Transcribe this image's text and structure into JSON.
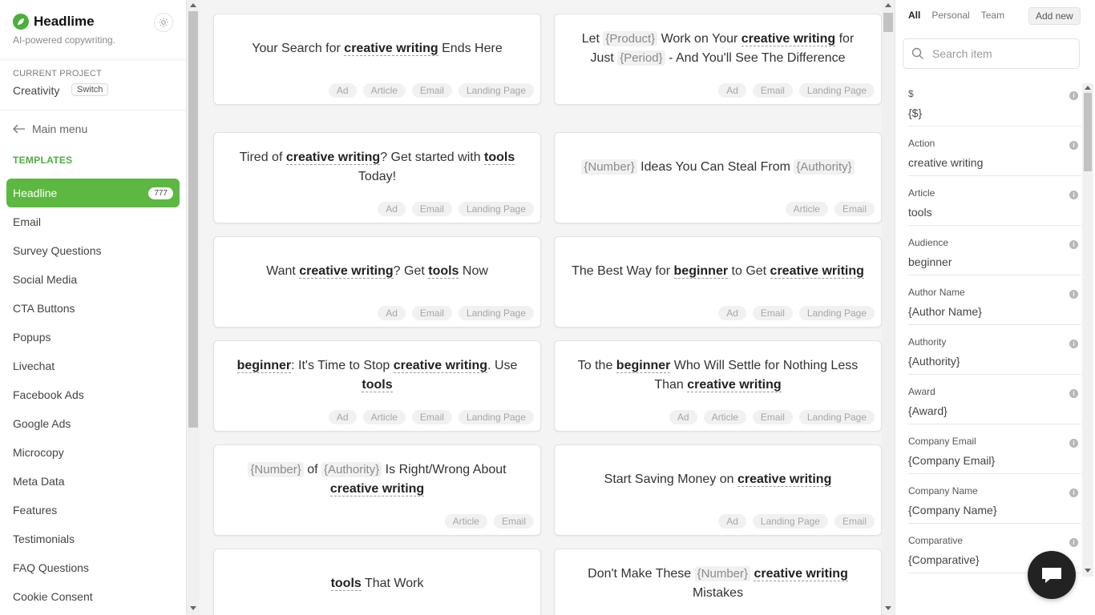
{
  "brand": {
    "name": "Headlime",
    "tagline": "AI-powered copywriting."
  },
  "project": {
    "label": "CURRENT PROJECT",
    "name": "Creativity",
    "switch_label": "Switch"
  },
  "nav": {
    "main_menu": "Main menu",
    "templates_label": "TEMPLATES"
  },
  "menu": [
    {
      "label": "Headline",
      "count": "777",
      "active": true
    },
    {
      "label": "Email"
    },
    {
      "label": "Survey Questions"
    },
    {
      "label": "Social Media"
    },
    {
      "label": "CTA Buttons"
    },
    {
      "label": "Popups"
    },
    {
      "label": "Livechat"
    },
    {
      "label": "Facebook Ads"
    },
    {
      "label": "Google Ads"
    },
    {
      "label": "Microcopy"
    },
    {
      "label": "Meta Data"
    },
    {
      "label": "Features"
    },
    {
      "label": "Testimonials"
    },
    {
      "label": "FAQ Questions"
    },
    {
      "label": "Cookie Consent"
    }
  ],
  "cards": [
    {
      "parts": [
        {
          "t": "Your Search for "
        },
        {
          "b": "creative writing"
        },
        {
          "t": " Ends Here"
        }
      ],
      "tags": [
        "Ad",
        "Article",
        "Email",
        "Landing Page"
      ]
    },
    {
      "parts": [
        {
          "t": "Let "
        },
        {
          "p": "{Product}"
        },
        {
          "t": " Work on Your "
        },
        {
          "b": "creative writing"
        },
        {
          "t": " for Just "
        },
        {
          "p": "{Period}"
        },
        {
          "t": " - And You'll See The Difference"
        }
      ],
      "tags": [
        "Ad",
        "Email",
        "Landing Page"
      ]
    },
    {
      "parts": [
        {
          "t": "Tired of "
        },
        {
          "b": "creative writing"
        },
        {
          "t": "? Get started with "
        },
        {
          "b": "tools"
        },
        {
          "t": " Today!"
        }
      ],
      "tags": [
        "Ad",
        "Email",
        "Landing Page"
      ]
    },
    {
      "parts": [
        {
          "p": "{Number}"
        },
        {
          "t": " Ideas You Can Steal From "
        },
        {
          "p": "{Authority}"
        }
      ],
      "tags": [
        "Article",
        "Email"
      ]
    },
    {
      "parts": [
        {
          "t": "Want "
        },
        {
          "b": "creative writing"
        },
        {
          "t": "? Get "
        },
        {
          "b": "tools"
        },
        {
          "t": " Now"
        }
      ],
      "tags": [
        "Ad",
        "Email",
        "Landing Page"
      ]
    },
    {
      "parts": [
        {
          "t": "The Best Way for "
        },
        {
          "b": "beginner"
        },
        {
          "t": " to Get "
        },
        {
          "b": "creative writing"
        }
      ],
      "tags": [
        "Ad",
        "Email",
        "Landing Page"
      ]
    },
    {
      "parts": [
        {
          "b": "beginner"
        },
        {
          "t": ": It's Time to Stop "
        },
        {
          "b": "creative writing"
        },
        {
          "t": ". Use "
        },
        {
          "b": "tools"
        }
      ],
      "tags": [
        "Ad",
        "Article",
        "Email",
        "Landing Page"
      ]
    },
    {
      "parts": [
        {
          "t": "To the "
        },
        {
          "b": "beginner"
        },
        {
          "t": " Who Will Settle for Nothing Less Than "
        },
        {
          "b": "creative writing"
        }
      ],
      "tags": [
        "Ad",
        "Article",
        "Email",
        "Landing Page"
      ]
    },
    {
      "parts": [
        {
          "p": "{Number}"
        },
        {
          "t": " of "
        },
        {
          "p": "{Authority}"
        },
        {
          "t": " Is Right/Wrong About "
        },
        {
          "b": "creative writing"
        }
      ],
      "tags": [
        "Article",
        "Email"
      ]
    },
    {
      "parts": [
        {
          "t": "Start Saving Money on "
        },
        {
          "b": "creative writing"
        }
      ],
      "tags": [
        "Ad",
        "Landing Page",
        "Email"
      ]
    },
    {
      "parts": [
        {
          "b": "tools"
        },
        {
          "t": " That Work"
        }
      ],
      "tags": []
    },
    {
      "parts": [
        {
          "t": "Don't Make These "
        },
        {
          "p": "{Number}"
        },
        {
          "t": " "
        },
        {
          "b": "creative writing"
        },
        {
          "t": " Mistakes"
        }
      ],
      "tags": []
    }
  ],
  "right_panel": {
    "tabs": [
      "All",
      "Personal",
      "Team"
    ],
    "add_new": "Add new",
    "search_placeholder": "Search item",
    "variables": [
      {
        "label": "$",
        "value": "{$}"
      },
      {
        "label": "Action",
        "value": "creative writing"
      },
      {
        "label": "Article",
        "value": "tools"
      },
      {
        "label": "Audience",
        "value": " beginner"
      },
      {
        "label": "Author Name",
        "value": "{Author Name}"
      },
      {
        "label": "Authority",
        "value": "{Authority}"
      },
      {
        "label": "Award",
        "value": "{Award}"
      },
      {
        "label": "Company Email",
        "value": "{Company Email}"
      },
      {
        "label": "Company Name",
        "value": "{Company Name}"
      },
      {
        "label": "Comparative",
        "value": "{Comparative}"
      }
    ]
  },
  "icons": {
    "info": "info-icon",
    "chat": "chat-icon",
    "search": "search-icon",
    "theme": "sun-icon",
    "back": "arrow-left-icon"
  },
  "colors": {
    "accent": "#5cb840",
    "templates_label": "#4caf3e",
    "chat_button": "#222222"
  }
}
